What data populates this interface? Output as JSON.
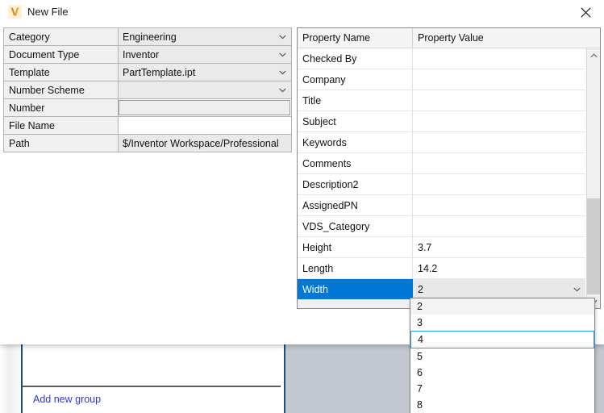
{
  "window": {
    "title": "New File",
    "icon": "vault-v-icon",
    "close_label": "Close",
    "accent_selection": "#0078d7",
    "link_color": "#3333cc"
  },
  "form": {
    "rows": [
      {
        "label": "Category",
        "value": "Engineering",
        "type": "combo"
      },
      {
        "label": "Document Type",
        "value": "Inventor",
        "type": "combo"
      },
      {
        "label": "Template",
        "value": "PartTemplate.ipt",
        "type": "combo"
      },
      {
        "label": "Number Scheme",
        "value": "",
        "type": "combo"
      },
      {
        "label": "Number",
        "value": "",
        "type": "disabled-input"
      },
      {
        "label": "File Name",
        "value": "",
        "type": "plain-white"
      },
      {
        "label": "Path",
        "value": "$/Inventor Workspace/Professional",
        "type": "path"
      }
    ]
  },
  "grid": {
    "headers": {
      "name": "Property Name",
      "value": "Property Value"
    },
    "rows": [
      {
        "name": "Checked By",
        "value": ""
      },
      {
        "name": "Company",
        "value": ""
      },
      {
        "name": "Title",
        "value": ""
      },
      {
        "name": "Subject",
        "value": ""
      },
      {
        "name": "Keywords",
        "value": ""
      },
      {
        "name": "Comments",
        "value": ""
      },
      {
        "name": "Description2",
        "value": ""
      },
      {
        "name": "AssignedPN",
        "value": ""
      },
      {
        "name": "VDS_Category",
        "value": ""
      },
      {
        "name": "Height",
        "value": "3.7"
      },
      {
        "name": "Length",
        "value": "14.2"
      },
      {
        "name": "Width",
        "value": "2"
      },
      {
        "name": "",
        "value": ""
      }
    ],
    "selected_row_index": 11
  },
  "dropdown": {
    "open": true,
    "selected_value": "2",
    "hovered_value": "4",
    "options": [
      "2",
      "3",
      "4",
      "5",
      "6",
      "7",
      "8"
    ]
  },
  "background": {
    "add_group_link": "Add new group"
  }
}
